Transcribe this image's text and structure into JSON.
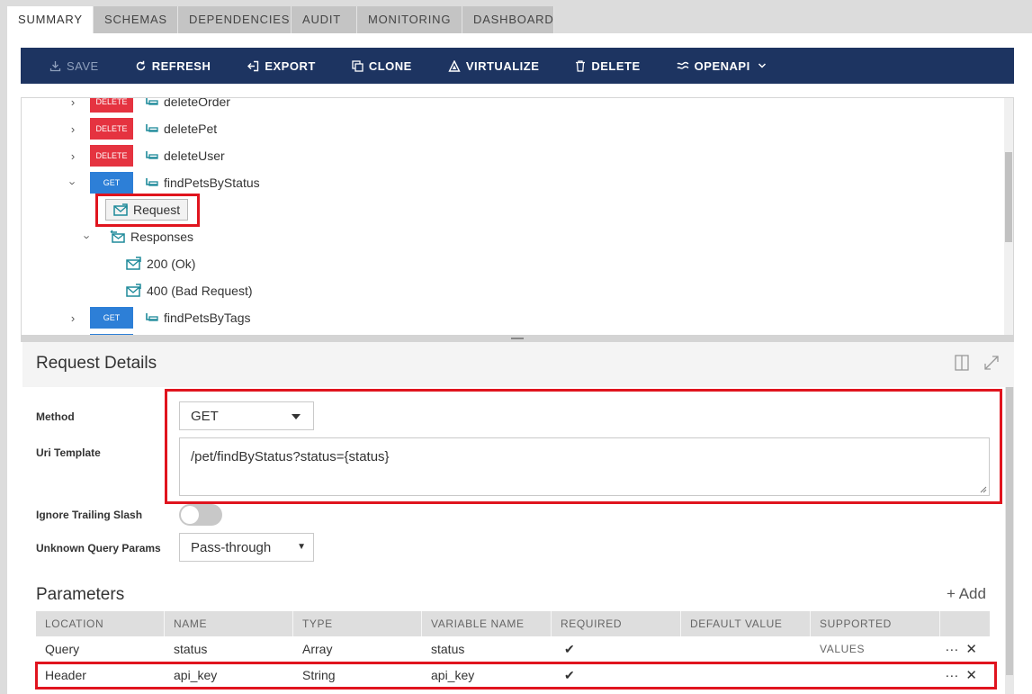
{
  "tabs": [
    {
      "label": "SUMMARY",
      "active": true
    },
    {
      "label": "SCHEMAS"
    },
    {
      "label": "DEPENDENCIES"
    },
    {
      "label": "AUDIT"
    },
    {
      "label": "MONITORING"
    },
    {
      "label": "DASHBOARD"
    }
  ],
  "toolbar": {
    "save": "SAVE",
    "refresh": "REFRESH",
    "export": "EXPORT",
    "clone": "CLONE",
    "virtualize": "VIRTUALIZE",
    "delete": "DELETE",
    "openapi": "OPENAPI"
  },
  "tree": {
    "ops": [
      {
        "method": "DELETE",
        "name": "deleteOrder"
      },
      {
        "method": "DELETE",
        "name": "deletePet"
      },
      {
        "method": "DELETE",
        "name": "deleteUser"
      },
      {
        "method": "GET",
        "name": "findPetsByStatus"
      },
      {
        "method": "GET",
        "name": "findPetsByTags"
      }
    ],
    "request": "Request",
    "responses": "Responses",
    "response_items": [
      "200 (Ok)",
      "400 (Bad Request)"
    ]
  },
  "details": {
    "title": "Request Details",
    "method_label": "Method",
    "method_value": "GET",
    "uri_label": "Uri Template",
    "uri_value": "/pet/findByStatus?status={status}",
    "trailing_label": "Ignore Trailing Slash",
    "unknown_label": "Unknown Query Params",
    "unknown_value": "Pass-through"
  },
  "parameters": {
    "title": "Parameters",
    "add": "+ Add",
    "columns": [
      "LOCATION",
      "NAME",
      "TYPE",
      "VARIABLE NAME",
      "REQUIRED",
      "DEFAULT VALUE",
      "SUPPORTED VALUES"
    ],
    "rows": [
      {
        "location": "Query",
        "name": "status",
        "type": "Array",
        "variable": "status",
        "required": "✔"
      },
      {
        "location": "Header",
        "name": "api_key",
        "type": "String",
        "variable": "api_key",
        "required": "✔"
      }
    ]
  },
  "colors": {
    "toolbar_bg": "#1d3461",
    "delete_badge": "#e53340",
    "get_badge": "#2d7fd7",
    "highlight": "#e0141e",
    "icon_teal": "#1e8a9a"
  }
}
